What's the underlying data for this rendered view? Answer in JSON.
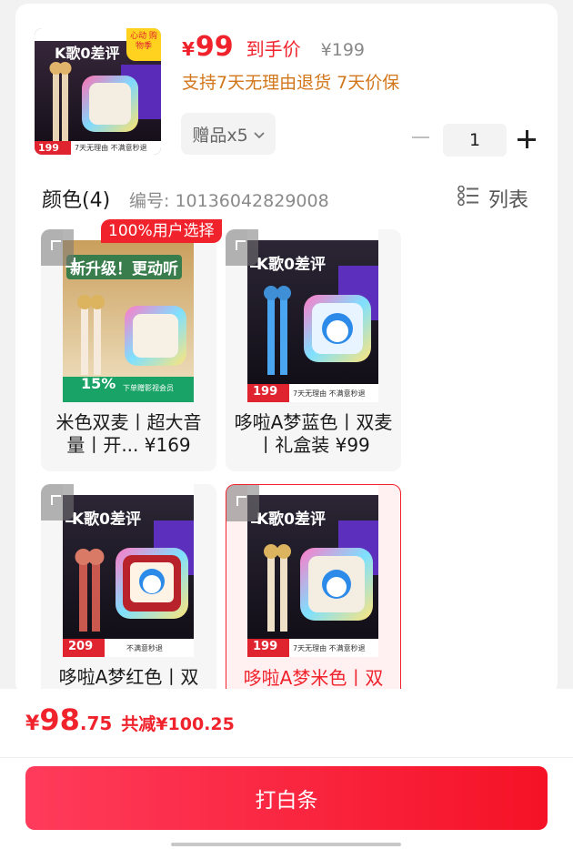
{
  "product": {
    "price_symbol": "¥",
    "price": "99",
    "price_tag": "到手价",
    "original_price": "¥199",
    "policy": "支持7天无理由退货  7天价保",
    "gifts_label": "赠品x5",
    "quantity": "1"
  },
  "thumbnail": {
    "title": "K歌0差评",
    "badge": "心动 购物季",
    "price": "199",
    "promo": "7天无理由  不满意秒退"
  },
  "section": {
    "title": "颜色(4)",
    "code": "编号: 10136042829008",
    "list_label": "列表"
  },
  "variants": [
    {
      "caption": "米色双麦丨超大音量丨开... ¥169",
      "badge": "100%用户选择",
      "img_title": "新升级！更动听",
      "img_pct": "15%",
      "img_footer": "下单赠影视会员"
    },
    {
      "caption": "哆啦A梦蓝色丨双麦丨礼盒装 ¥99",
      "img_title": "K歌0差评",
      "img_price": "199",
      "img_footer": "7天无理由  不满意秒退"
    },
    {
      "caption": "哆啦A梦红色丨双",
      "img_title": "K歌0差评",
      "img_price": "209",
      "img_footer": "不满意秒退"
    },
    {
      "caption": "哆啦A梦米色丨双",
      "img_title": "K歌0差评",
      "img_price": "199",
      "img_footer": "7天无理由  不满意秒退"
    }
  ],
  "footer": {
    "total_symbol": "¥",
    "total_int": "98",
    "total_dec": ".75",
    "discount": "共减¥100.25",
    "pay_button": "打白条"
  },
  "colors": {
    "accent": "#f0232d",
    "policy": "#d2761a",
    "button_start": "#ff3b5b",
    "button_end": "#f51226"
  }
}
